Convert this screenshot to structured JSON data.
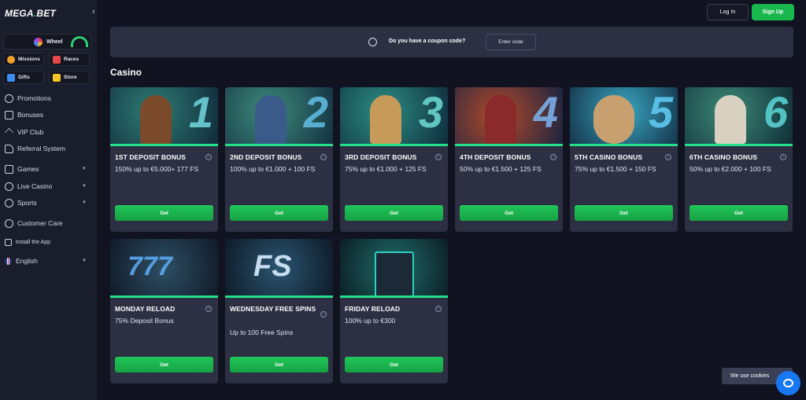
{
  "sidebar": {
    "logo": "MEGA",
    "logo_dot": ".",
    "logo_suffix": "BET",
    "wheel_label": "Wheel",
    "chips": [
      {
        "label": "Missions",
        "icon": "target-icon",
        "color": "#f2a02b"
      },
      {
        "label": "Races",
        "icon": "flag-icon",
        "color": "#e6474b"
      },
      {
        "label": "Gifts",
        "icon": "gift-icon",
        "color": "#3c8cf0"
      },
      {
        "label": "Store",
        "icon": "cart-icon",
        "color": "#f2c524"
      }
    ],
    "items": [
      {
        "label": "Promotions",
        "icon": "promotions-icon",
        "has_chevron": false
      },
      {
        "label": "Bonuses",
        "icon": "bonuses-icon",
        "has_chevron": false
      },
      {
        "label": "VIP Club",
        "icon": "vip-icon",
        "has_chevron": false
      },
      {
        "label": "Referral System",
        "icon": "referral-icon",
        "has_chevron": false
      },
      {
        "label": "Games",
        "icon": "games-icon",
        "has_chevron": true
      },
      {
        "label": "Live Casino",
        "icon": "live-casino-icon",
        "has_chevron": true
      },
      {
        "label": "Sports",
        "icon": "sports-icon",
        "has_chevron": true
      },
      {
        "label": "Customer Care",
        "icon": "customer-care-icon",
        "has_chevron": false
      },
      {
        "label": "Install the App",
        "icon": "install-app-icon",
        "has_chevron": false
      },
      {
        "label": "English",
        "icon": "uk-flag-icon",
        "has_chevron": true
      }
    ]
  },
  "header": {
    "login_label": "Log In",
    "signup_label": "Sign Up"
  },
  "coupon": {
    "question": "Do you have a coupon code?",
    "enter_label": "Enter code"
  },
  "section_title": "Casino",
  "cards": [
    {
      "title": "1ST DEPOSIT BONUS",
      "desc": "150% up to €5.000+ 177 FS",
      "button": "Get",
      "art_digit": "1",
      "digit_color": "#6fd0d8"
    },
    {
      "title": "2ND DEPOSIT BONUS",
      "desc": "100% up to €1.000 + 100 FS",
      "button": "Get",
      "art_digit": "2",
      "digit_color": "#5fb9e0"
    },
    {
      "title": "3RD DEPOSIT BONUS",
      "desc": "75% up to €1.000 + 125 FS",
      "button": "Get",
      "art_digit": "3",
      "digit_color": "#6ad4cc"
    },
    {
      "title": "4TH DEPOSIT BONUS",
      "desc": "50% up to €1.500 + 125 FS",
      "button": "Get",
      "art_digit": "4",
      "digit_color": "#7aaee8"
    },
    {
      "title": "5TH CASINO BONUS",
      "desc": "75% up to €1.500 + 150 FS",
      "button": "Get",
      "art_digit": "5",
      "digit_color": "#5fc8f0"
    },
    {
      "title": "6TH CASINO BONUS",
      "desc": "50% up to €2.000 + 100 FS",
      "button": "Get",
      "art_digit": "6",
      "digit_color": "#5ad0d0"
    },
    {
      "title": "MONDAY RELOAD",
      "desc": "75% Deposit Bonus",
      "button": "Get",
      "art_digit": "777",
      "digit_color": "#5aa8f0"
    },
    {
      "title": "WEDNESDAY FREE SPINS",
      "desc": "Up to 100 Free Spins",
      "button": "Get",
      "art_digit": "FS",
      "digit_color": "#d8ecff"
    },
    {
      "title": "FRIDAY RELOAD",
      "desc": "100% up to €300",
      "button": "Get",
      "art_digit": "",
      "digit_color": "#2fd0c0"
    }
  ],
  "cookie_text": "We use cookies"
}
